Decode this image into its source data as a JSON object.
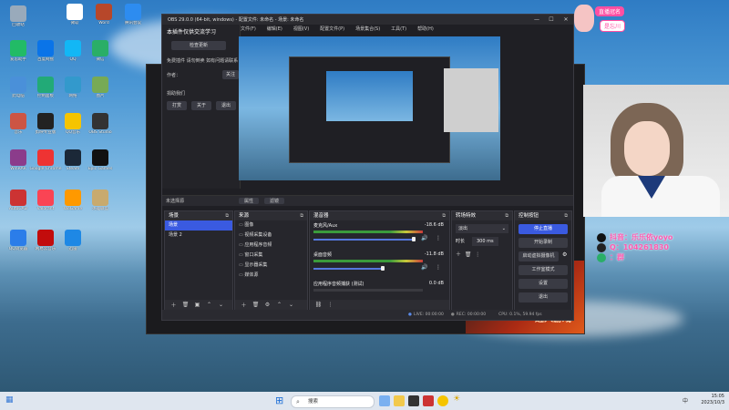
{
  "desktop_icons": [
    {
      "label": "回收站",
      "color": "#9ab"
    },
    {
      "label": "爱思助手",
      "color": "#2b6"
    },
    {
      "label": "百度网盘",
      "color": "#0a74e8"
    },
    {
      "label": "QQ",
      "color": "#12b7f5"
    },
    {
      "label": "微信",
      "color": "#2aae67"
    },
    {
      "label": "此电脑",
      "color": "#4a90d9"
    },
    {
      "label": "控制面板",
      "color": "#2a7"
    },
    {
      "label": "网络",
      "color": "#39c"
    },
    {
      "label": "图片",
      "color": "#7a5"
    },
    {
      "label": "音乐",
      "color": "#c54"
    },
    {
      "label": "剪映专业版",
      "color": "#222"
    },
    {
      "label": "QQ音乐",
      "color": "#f5c400"
    },
    {
      "label": "OBS Studio",
      "color": "#333"
    },
    {
      "label": "WinRAR",
      "color": "#8b3c8b"
    },
    {
      "label": "Google Chrome",
      "color": "#e33"
    },
    {
      "label": "Steam",
      "color": "#1b2838"
    },
    {
      "label": "Epic Games",
      "color": "#111"
    },
    {
      "label": "AutoCAD",
      "color": "#c33"
    },
    {
      "label": "Valorant",
      "color": "#fa4454"
    },
    {
      "label": "WeGame",
      "color": "#f90"
    },
    {
      "label": "英雄联盟",
      "color": "#c8aa6e"
    },
    {
      "label": "QQ浏览器",
      "color": "#2b7de9"
    },
    {
      "label": "网易云音乐",
      "color": "#c20c0c"
    },
    {
      "label": "迅雷",
      "color": "#1e88e5"
    }
  ],
  "top_icons": [
    {
      "label": "微软",
      "color": "#fff"
    },
    {
      "label": "Word",
      "color": "#b7472a"
    },
    {
      "label": "腾讯会议",
      "color": "#2d8cf0"
    }
  ],
  "obs": {
    "title": "OBS 29.0.0 (64-bit, windows) - 配置文件: 未命名 - 场景: 未命名",
    "menu": [
      "文件(F)",
      "编辑(E)",
      "视图(V)",
      "配置文件(P)",
      "场景集合(S)",
      "工具(T)",
      "帮助(H)"
    ],
    "plugin_panel": {
      "heading": "本插件仅供交流学习",
      "btn_check": "检查更新",
      "text1": "免费插件 请勿倒卖 如有问题请联系",
      "author": "作者：",
      "btn_author": "关注",
      "text2": "捐助我们",
      "buttons": [
        "打赏",
        "关于",
        "退出"
      ]
    },
    "status_left": "未选择源",
    "status_btn1": "属性",
    "status_btn2": "滤镜",
    "scenes": {
      "title": "场景",
      "items": [
        "场景",
        "场景 2"
      ]
    },
    "sources": {
      "title": "来源",
      "items": [
        "图像",
        "视频采集设备",
        "应用程序音频",
        "窗口采集",
        "显示器采集",
        "媒体源"
      ]
    },
    "mixer": {
      "title": "混音器",
      "channels": [
        {
          "name": "麦克风/Aux",
          "db": "-18.6 dB"
        },
        {
          "name": "桌面音频",
          "db": "-11.8 dB"
        },
        {
          "name": "应用程序音频捕获 (测试)",
          "db": "0.0 dB"
        }
      ]
    },
    "transitions": {
      "title": "转场特效",
      "type": "淡出",
      "duration_label": "时长",
      "duration": "300 ms"
    },
    "controls": {
      "title": "控制按钮",
      "buttons": [
        "停止直播",
        "开始录制",
        "启动虚拟摄像机",
        "工作室模式",
        "设置",
        "退出"
      ]
    },
    "footer": {
      "live": "LIVE: 00:00:00",
      "rec": "REC: 00:00:00",
      "cpu": "CPU: 0.1%, 59.94 fps"
    }
  },
  "overlay": {
    "badge_main": "直播冠名",
    "badge_sub": "是忘川",
    "douyin_label": "抖音：",
    "douyin_value": "乐乐依yoyo",
    "qq_label": "Q：",
    "qq_value": "104261830",
    "wechat_label": "：",
    "wechat_value": "群"
  },
  "back_window_text": "进入游戏",
  "taskbar": {
    "search_placeholder": "搜索",
    "time": "15:05",
    "date": "2023/10/3",
    "tray": "中"
  }
}
